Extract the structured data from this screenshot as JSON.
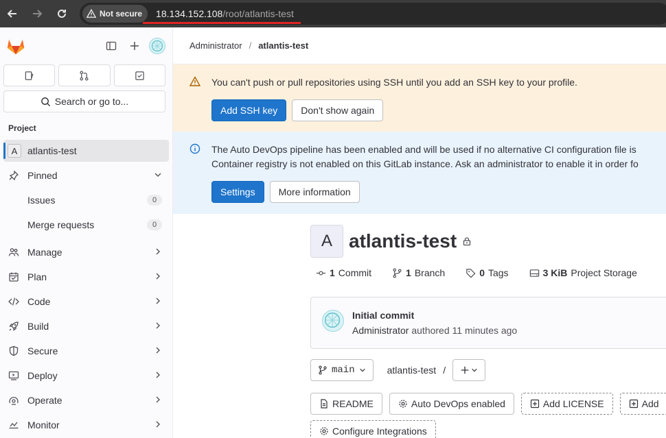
{
  "browser": {
    "security_label": "Not secure",
    "url_host": "18.134.152.108",
    "url_path": "/root/atlantis-test"
  },
  "sidebar": {
    "search_label": "Search or go to...",
    "section_title": "Project",
    "project": {
      "letter": "A",
      "name": "atlantis-test"
    },
    "pinned_label": "Pinned",
    "pinned_items": [
      {
        "label": "Issues",
        "count": "0"
      },
      {
        "label": "Merge requests",
        "count": "0"
      }
    ],
    "nav_items": [
      {
        "label": "Manage",
        "icon": "users-icon"
      },
      {
        "label": "Plan",
        "icon": "calendar-icon"
      },
      {
        "label": "Code",
        "icon": "code-icon"
      },
      {
        "label": "Build",
        "icon": "rocket-icon"
      },
      {
        "label": "Secure",
        "icon": "shield-icon"
      },
      {
        "label": "Deploy",
        "icon": "deploy-icon"
      },
      {
        "label": "Operate",
        "icon": "operate-icon"
      },
      {
        "label": "Monitor",
        "icon": "monitor-icon"
      }
    ]
  },
  "breadcrumb": {
    "parent": "Administrator",
    "separator": "/",
    "current": "atlantis-test"
  },
  "ssh_alert": {
    "text": "You can't push or pull repositories using SSH until you add an SSH key to your profile.",
    "primary_label": "Add SSH key",
    "secondary_label": "Don't show again"
  },
  "devops_alert": {
    "line1": "The Auto DevOps pipeline has been enabled and will be used if no alternative CI configuration file is",
    "line2": "Container registry is not enabled on this GitLab instance. Ask an administrator to enable it in order fo",
    "primary_label": "Settings",
    "secondary_label": "More information"
  },
  "project": {
    "avatar_letter": "A",
    "title": "atlantis-test",
    "stats": {
      "commits_count": "1",
      "commits_label": "Commit",
      "branches_count": "1",
      "branches_label": "Branch",
      "tags_count": "0",
      "tags_label": "Tags",
      "storage_size": "3 KiB",
      "storage_label": "Project Storage"
    }
  },
  "last_commit": {
    "title": "Initial commit",
    "author": "Administrator",
    "action": "authored",
    "time": "11 minutes ago"
  },
  "repo": {
    "branch": "main",
    "path": "atlantis-test",
    "path_sep": "/"
  },
  "repo_links": {
    "readme": "README",
    "auto_devops": "Auto DevOps enabled",
    "add_license": "Add LICENSE",
    "add_more": "Add",
    "configure_integrations": "Configure Integrations"
  },
  "colors": {
    "primary_blue": "#1f75cb",
    "warning_bg": "#fdf1dd",
    "info_bg": "#e9f3fc",
    "warning_icon": "#ab6100",
    "info_icon": "#1f75cb"
  }
}
